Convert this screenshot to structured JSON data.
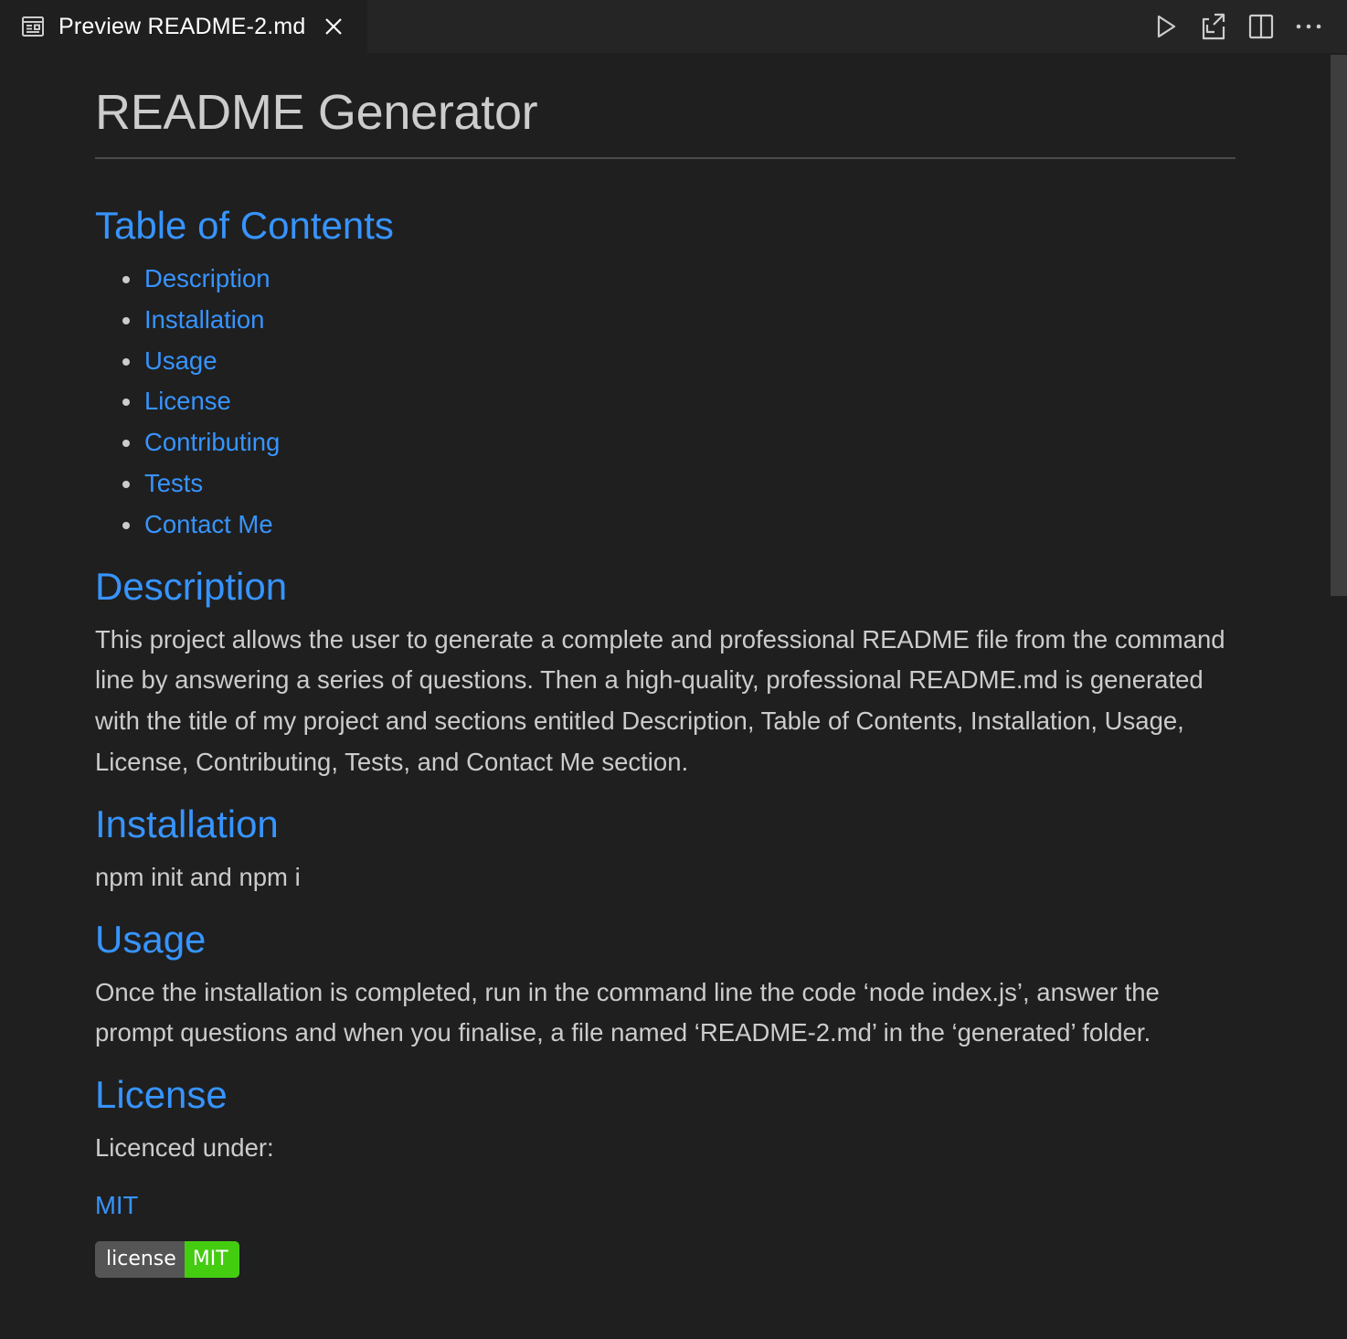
{
  "tab": {
    "label": "Preview README-2.md",
    "icon": "preview-icon",
    "close_icon": "close-icon"
  },
  "toolbar": {
    "actions": [
      "run-icon",
      "open-source-icon",
      "split-editor-icon",
      "more-actions-icon"
    ]
  },
  "doc": {
    "title": "README Generator",
    "toc_heading": "Table of Contents",
    "toc": [
      "Description",
      "Installation",
      "Usage",
      "License",
      "Contributing",
      "Tests",
      "Contact Me"
    ],
    "description": {
      "heading": "Description",
      "text": "This project allows the user to generate a complete and professional README file from the command line by answering a series of questions. Then a high-quality, professional README.md is generated with the title of my project and sections entitled Description, Table of Contents, Installation, Usage, License, Contributing, Tests, and Contact Me section."
    },
    "installation": {
      "heading": "Installation",
      "text": "npm init and npm i"
    },
    "usage": {
      "heading": "Usage",
      "text": "Once the installation is completed, run in the command line the code ‘node index.js’, answer the prompt questions and when you finalise, a file named ‘README-2.md’ in the ‘generated’ folder."
    },
    "license": {
      "heading": "License",
      "text": "Licenced under:",
      "link": "MIT",
      "badge_left": "license",
      "badge_right": "MIT"
    }
  },
  "colors": {
    "background": "#1f1f1f",
    "text": "#cccccc",
    "link": "#3794ff",
    "badge_green": "#44cc11"
  }
}
